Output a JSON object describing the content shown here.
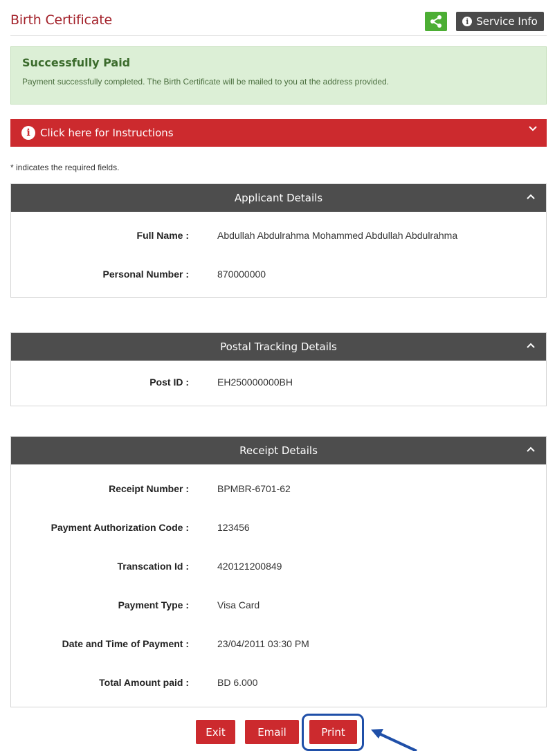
{
  "header": {
    "title": "Birth Certificate",
    "share_icon": "share-icon",
    "service_info_label": "Service Info"
  },
  "alert": {
    "title": "Successfully Paid",
    "message": "Payment successfully completed. The Birth Certificate will be mailed to you at the address provided."
  },
  "instructions": {
    "label": "Click here for Instructions"
  },
  "required_note": "* indicates the required fields.",
  "applicant": {
    "heading": "Applicant Details",
    "rows": [
      {
        "label": "Full Name :",
        "value": "Abdullah Abdulrahma Mohammed Abdullah Abdulrahma"
      },
      {
        "label": "Personal Number :",
        "value": "870000000"
      }
    ]
  },
  "postal": {
    "heading": "Postal Tracking Details",
    "rows": [
      {
        "label": "Post ID :",
        "value": "EH250000000BH"
      }
    ]
  },
  "receipt": {
    "heading": "Receipt Details",
    "rows": [
      {
        "label": "Receipt Number :",
        "value": "BPMBR-6701-62"
      },
      {
        "label": "Payment Authorization Code :",
        "value": "123456"
      },
      {
        "label": "Transcation Id :",
        "value": "420121200849"
      },
      {
        "label": "Payment Type :",
        "value": "Visa Card"
      },
      {
        "label": "Date and Time of Payment :",
        "value": "23/04/2011 03:30 PM"
      },
      {
        "label": "Total Amount paid :",
        "value": "BD 6.000"
      }
    ]
  },
  "actions": {
    "exit_label": "Exit",
    "email_label": "Email",
    "print_label": "Print"
  },
  "colors": {
    "brand_red": "#cc2a2e",
    "title_red": "#a3212a",
    "success_bg": "#dcefd6",
    "panel_head": "#4d4d4d",
    "share_green": "#4cae34",
    "highlight_blue": "#1f4fa8"
  }
}
